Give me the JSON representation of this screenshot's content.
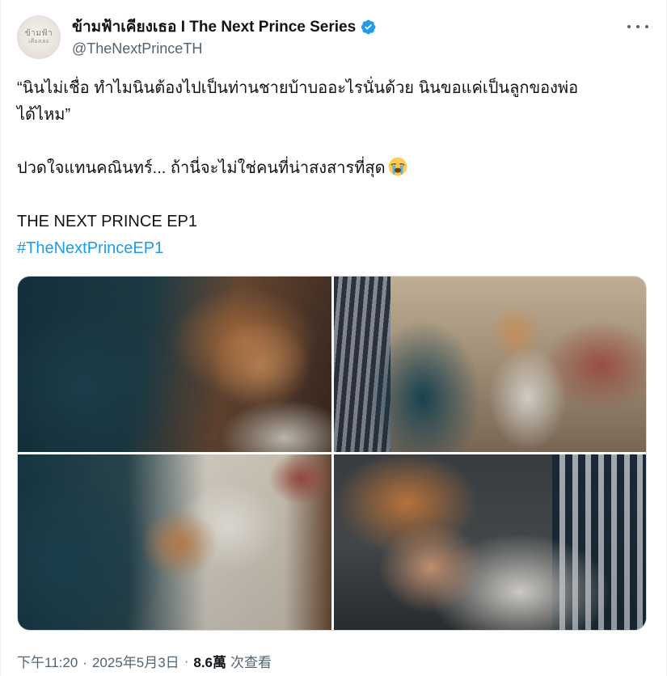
{
  "author": {
    "display_name": "ข้ามฟ้าเคียงเธอ I The Next Prince Series",
    "handle": "@TheNextPrinceTH",
    "verified": true,
    "avatar_text_line1": "ข้ามฟ้า",
    "avatar_text_line2": "เคียงเธอ",
    "avatar_icon": "logo-avatar"
  },
  "more_icon": "more-icon",
  "tweet": {
    "line1": "“นินไม่เชื่อ ทำไมนินต้องไปเป็นท่านชายบ้าบออะไรนั่นด้วย นินขอแค่เป็นลูกของพ่อ",
    "line2": "ได้ไหม”",
    "line3": "ปวดใจแทนคณินทร์... ถ้านี่จะไม่ใช่คนที่น่าสงสารที่สุด",
    "line3_emoji": "loudly-crying-face-emoji",
    "line4": "THE NEXT PRINCE EP1",
    "hashtag": "#TheNextPrinceEP1"
  },
  "media": {
    "photos": [
      {
        "name": "photo-1"
      },
      {
        "name": "photo-2"
      },
      {
        "name": "photo-3"
      },
      {
        "name": "photo-4"
      }
    ]
  },
  "meta": {
    "time": "下午11:20",
    "date": "2025年5月3日",
    "separator": "·",
    "views_count": "8.6萬",
    "views_label": "次查看"
  },
  "colors": {
    "text": "#0f1419",
    "secondary": "#536471",
    "link": "#1d9bf0",
    "verified": "#1d9bf0"
  }
}
